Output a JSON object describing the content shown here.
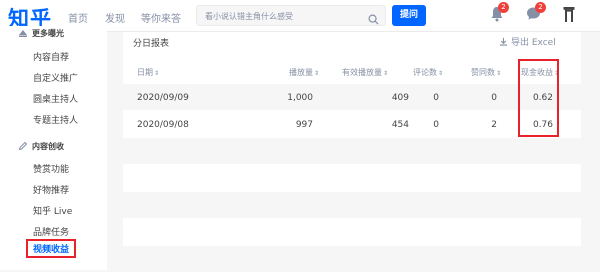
{
  "header": {
    "logo": "知乎",
    "nav": [
      "首页",
      "发现",
      "等你来答"
    ],
    "search_placeholder": "看小说认错主角什么感受",
    "ask_label": "提问",
    "notif_count": "2",
    "msg_count": "2"
  },
  "sidebar": {
    "section1_title": "更多曝光",
    "section1_items": [
      "内容自荐",
      "自定义推广",
      "圆桌主持人",
      "专题主持人"
    ],
    "section2_title": "内容创收",
    "section2_items": [
      "赞赏功能",
      "好物推荐",
      "知乎 Live",
      "品牌任务",
      "视频收益"
    ]
  },
  "table": {
    "title": "分日报表",
    "export_label": "导出 Excel",
    "headers": [
      "日期",
      "播放量",
      "有效播放量",
      "评论数",
      "赞同数",
      "现金收益"
    ],
    "rows": [
      [
        "2020/09/09",
        "1,000",
        "409",
        "0",
        "0",
        "0.62"
      ],
      [
        "2020/09/08",
        "997",
        "454",
        "0",
        "2",
        "0.76"
      ]
    ]
  },
  "colors": {
    "brand": "#0066ff",
    "highlight": "#e8212a",
    "badge": "#f1403c"
  }
}
